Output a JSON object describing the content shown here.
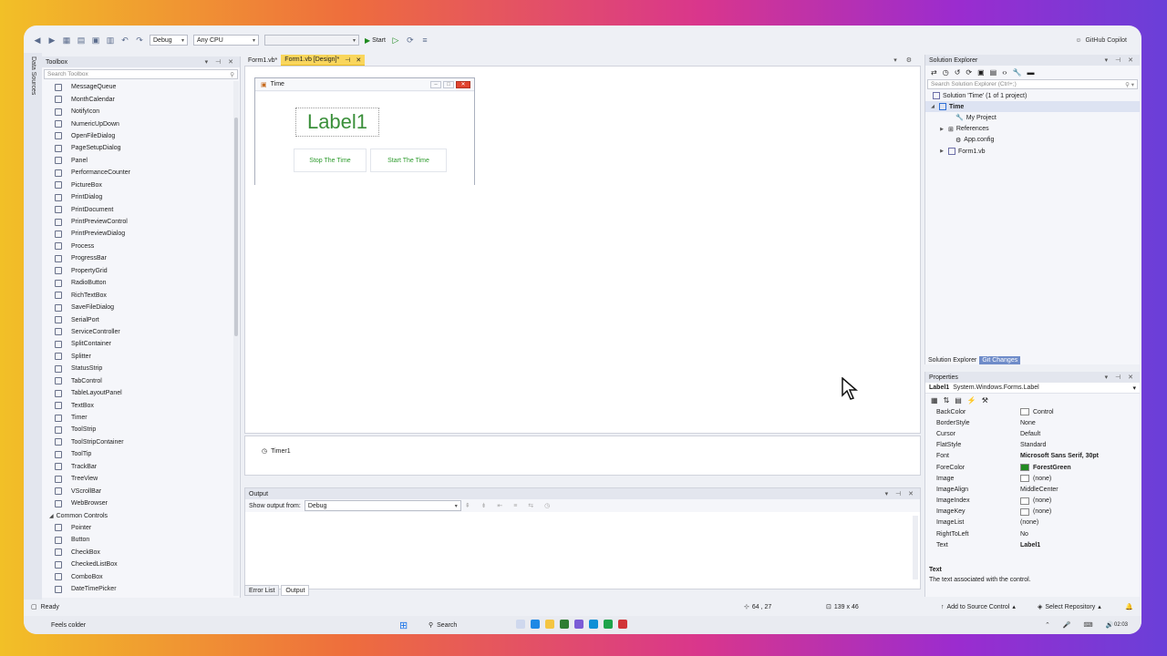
{
  "toolbar": {
    "config": "Debug",
    "platform": "Any CPU",
    "start_label": "Start",
    "copilot_label": "GitHub Copilot"
  },
  "sidebar_strip": "Data Sources",
  "toolbox": {
    "title": "Toolbox",
    "search_placeholder": "Search Toolbox",
    "items": [
      "MessageQueue",
      "MonthCalendar",
      "NotifyIcon",
      "NumericUpDown",
      "OpenFileDialog",
      "PageSetupDialog",
      "Panel",
      "PerformanceCounter",
      "PictureBox",
      "PrintDialog",
      "PrintDocument",
      "PrintPreviewControl",
      "PrintPreviewDialog",
      "Process",
      "ProgressBar",
      "PropertyGrid",
      "RadioButton",
      "RichTextBox",
      "SaveFileDialog",
      "SerialPort",
      "ServiceController",
      "SplitContainer",
      "Splitter",
      "StatusStrip",
      "TabControl",
      "TableLayoutPanel",
      "TextBox",
      "Timer",
      "ToolStrip",
      "ToolStripContainer",
      "ToolTip",
      "TrackBar",
      "TreeView",
      "VScrollBar",
      "WebBrowser"
    ],
    "group": "Common Controls",
    "group_items": [
      "Pointer",
      "Button",
      "CheckBox",
      "CheckedListBox",
      "ComboBox",
      "DateTimePicker"
    ]
  },
  "doc_tabs": [
    {
      "label": "Form1.vb*"
    },
    {
      "label": "Form1.vb [Design]*"
    }
  ],
  "form": {
    "title": "Time",
    "label": "Label1",
    "stop_button": "Stop The Time",
    "start_button": "Start The Time"
  },
  "tray": {
    "timer": "Timer1"
  },
  "output": {
    "title": "Output",
    "show_from_label": "Show output from:",
    "source": "Debug"
  },
  "bottom_tabs": [
    "Error List",
    "Output"
  ],
  "solution_explorer": {
    "title": "Solution Explorer",
    "search_placeholder": "Search Solution Explorer (Ctrl+;)",
    "solution": "Solution 'Time' (1 of 1 project)",
    "project": "Time",
    "nodes": [
      "My Project",
      "References",
      "App.config",
      "Form1.vb"
    ],
    "tab_active": "Solution Explorer",
    "tab_git": "Git Changes"
  },
  "properties": {
    "title": "Properties",
    "object": "Label1",
    "object_type": "System.Windows.Forms.Label",
    "rows": [
      {
        "name": "BackColor",
        "value": "Control",
        "swatch": "#ffffff"
      },
      {
        "name": "BorderStyle",
        "value": "None"
      },
      {
        "name": "Cursor",
        "value": "Default"
      },
      {
        "name": "FlatStyle",
        "value": "Standard"
      },
      {
        "name": "Font",
        "value": "Microsoft Sans Serif, 30pt",
        "bold": true
      },
      {
        "name": "ForeColor",
        "value": "ForestGreen",
        "swatch": "#228b22",
        "bold": true
      },
      {
        "name": "Image",
        "value": "(none)",
        "swatch": "#ffffff"
      },
      {
        "name": "ImageAlign",
        "value": "MiddleCenter"
      },
      {
        "name": "ImageIndex",
        "value": "(none)",
        "swatch": "#ffffff"
      },
      {
        "name": "ImageKey",
        "value": "(none)",
        "swatch": "#ffffff"
      },
      {
        "name": "ImageList",
        "value": "(none)"
      },
      {
        "name": "RightToLeft",
        "value": "No"
      },
      {
        "name": "Text",
        "value": "Label1",
        "bold": true
      }
    ],
    "desc_title": "Text",
    "desc_text": "The text associated with the control."
  },
  "status": {
    "ready": "Ready",
    "position": "64 , 27",
    "size": "139 x 46",
    "source_control": "Add to Source Control",
    "repo": "Select Repository"
  },
  "taskbar": {
    "weather": "Feels colder",
    "search": "Search",
    "time": "02:03"
  },
  "colors": {
    "accent": "#f9d65c",
    "form_text": "#3a8f3a"
  }
}
